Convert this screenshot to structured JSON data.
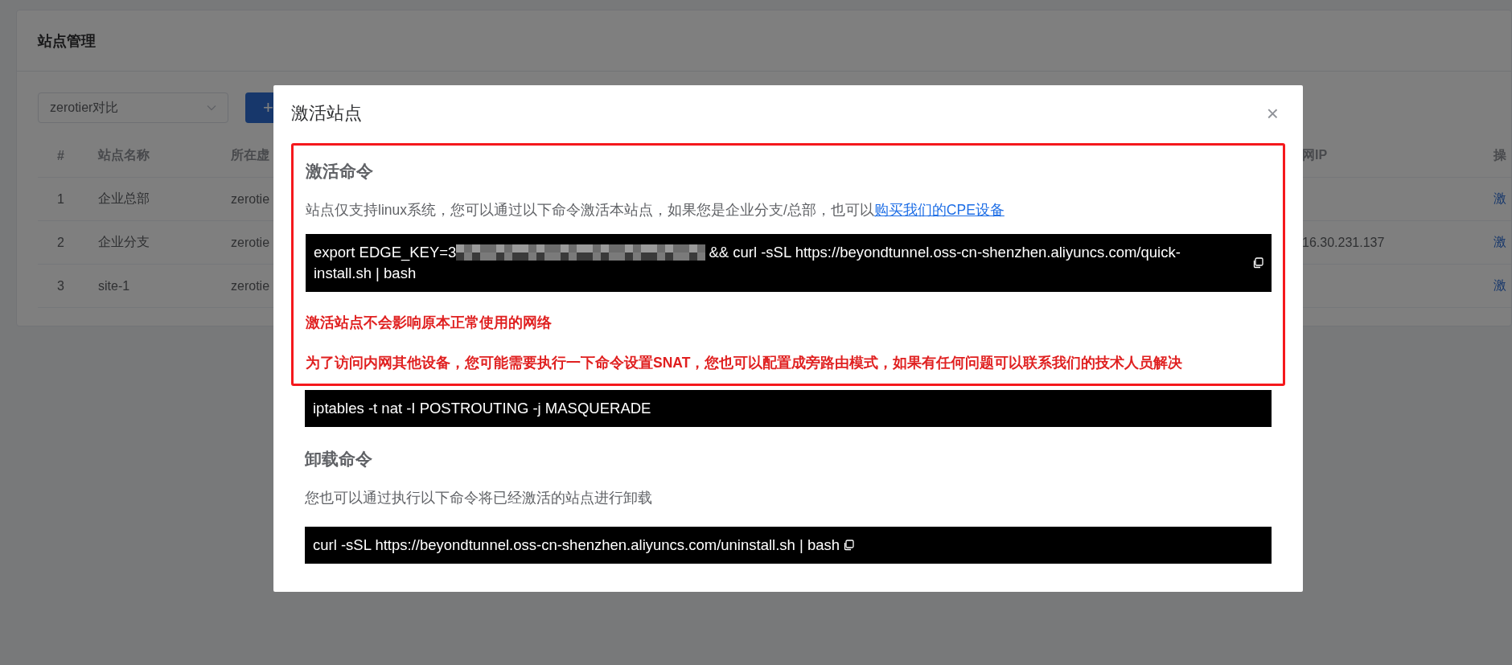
{
  "page": {
    "title": "站点管理",
    "network_select": {
      "value": "zerotier对比"
    },
    "add_button": {
      "label": "+"
    },
    "table": {
      "columns": [
        "#",
        "站点名称",
        "所在虚",
        "网IP",
        "操"
      ],
      "rows": [
        {
          "cells": [
            "1",
            "企业总部",
            "zerotie",
            "",
            "激"
          ]
        },
        {
          "cells": [
            "2",
            "企业分支",
            "zerotie",
            "16.30.231.137",
            "激"
          ]
        },
        {
          "cells": [
            "3",
            "site-1",
            "zerotie",
            "",
            "激"
          ]
        }
      ]
    }
  },
  "dialog": {
    "title": "激活站点",
    "close": "×",
    "activate": {
      "heading": "激活命令",
      "text": "站点仅支持linux系统，您可以通过以下命令激活本站点，如果您是企业分支/总部，也可以",
      "link": "购买我们的CPE设备",
      "command_prefix": "export EDGE_KEY=3",
      "command_lines": [
        "&& curl -sSL https://beyondtunnel.oss-cn-shenzhen.aliyuncs.com/quick-",
        "install.sh | bash"
      ],
      "warnings": [
        "激活站点不会影响原本正常使用的网络",
        "为了访问内网其他设备，您可能需要执行一下命令设置SNAT，您也可以配置成旁路由模式，如果有任何问题可以联系我们的技术人员解决"
      ],
      "snat_command": "iptables -t nat -I POSTROUTING -j MASQUERADE"
    },
    "uninstall": {
      "heading": "卸载命令",
      "text": "您也可以通过执行以下命令将已经激活的站点进行卸载",
      "command": "curl -sSL https://beyondtunnel.oss-cn-shenzhen.aliyuncs.com/uninstall.sh | bash"
    }
  }
}
